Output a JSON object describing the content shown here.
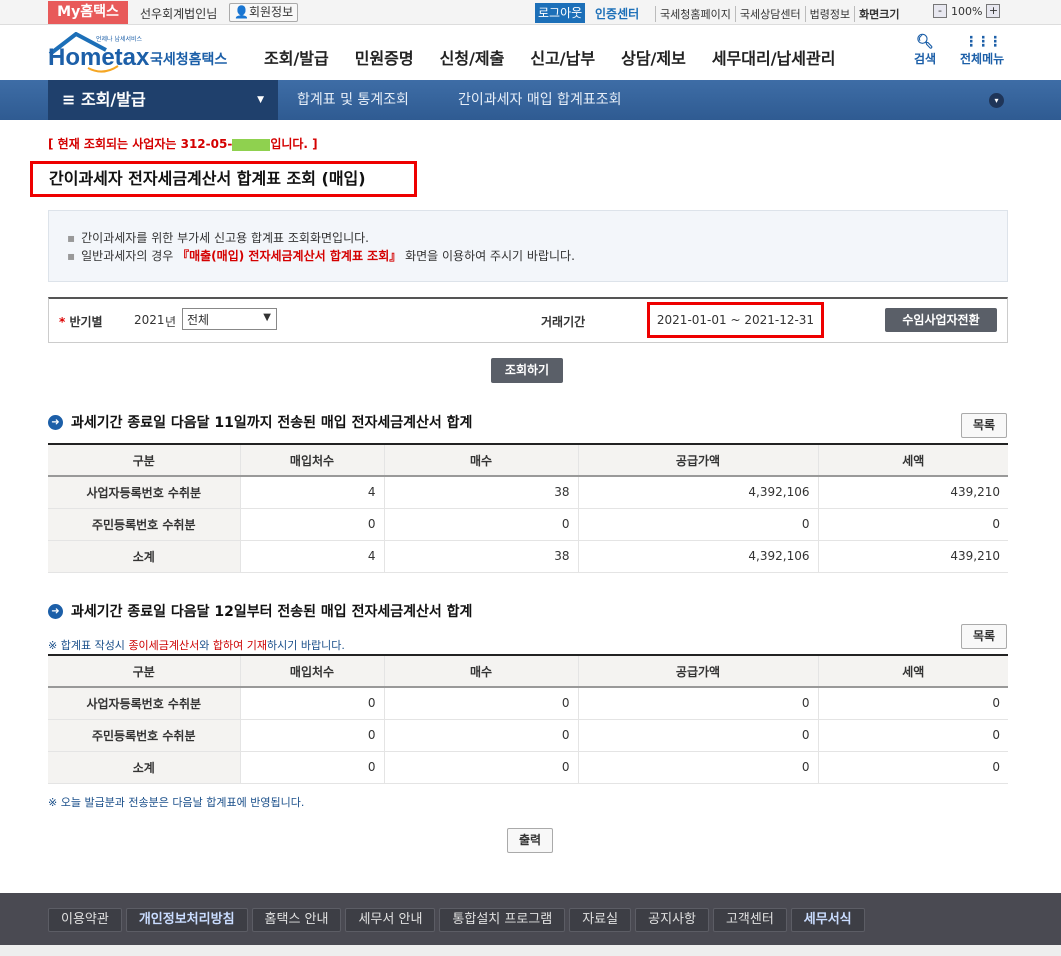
{
  "topbar": {
    "my_hometax": "My홈택스",
    "user_name": "선우회계법인님",
    "member_info": "회원정보",
    "logout": "로그아웃",
    "cert_center": "인증센터",
    "links": [
      "국세청홈페이지",
      "국세상담센터",
      "법령정보",
      "화면크기"
    ],
    "zoom": "100%",
    "zoom_minus": "-",
    "zoom_plus": "+"
  },
  "header": {
    "logo_text": "Hometax",
    "logo_sub": "국세청홈택스",
    "logo_tag": "언제나 납세서비스",
    "nav": [
      "조회/발급",
      "민원증명",
      "신청/제출",
      "신고/납부",
      "상담/제보",
      "세무대리/납세관리"
    ],
    "search": "검색",
    "all_menu": "전체메뉴"
  },
  "breadcrumb": {
    "menu": "조회/발급",
    "items": [
      "합계표 및 통계조회",
      "간이과세자 매입 합계표조회"
    ]
  },
  "notice": {
    "prefix": "[ 현재 조회되는 사업자는 312-05-",
    "suffix": "입니다. ]"
  },
  "page_title": "간이과세자 전자세금계산서 합계표 조회 (매입)",
  "info": {
    "line1": "간이과세자를 위한 부가세 신고용 합계표 조회화면입니다.",
    "line2_pre": "일반과세자의 경우 ",
    "line2_link": "『매출(매입) 전자세금계산서 합계표 조회』",
    "line2_post": " 화면을 이용하여 주시기 바랍니다."
  },
  "search": {
    "label": "반기별",
    "year": "2021",
    "year_unit": "년",
    "period_selected": "전체",
    "trade_period_label": "거래기간",
    "trade_period": "2021-01-01 ~ 2021-12-31",
    "switch_button": "수임사업자전환",
    "query_button": "조회하기"
  },
  "section1": {
    "title": "과세기간 종료일 다음달 11일까지 전송된 매입 전자세금계산서 합계",
    "list_button": "목록",
    "headers": [
      "구분",
      "매입처수",
      "매수",
      "공급가액",
      "세액"
    ],
    "rows": [
      [
        "사업자등록번호 수취분",
        "4",
        "38",
        "4,392,106",
        "439,210"
      ],
      [
        "주민등록번호 수취분",
        "0",
        "0",
        "0",
        "0"
      ],
      [
        "소계",
        "4",
        "38",
        "4,392,106",
        "439,210"
      ]
    ]
  },
  "section2": {
    "title": "과세기간 종료일 다음달 12일부터 전송된 매입 전자세금계산서 합계",
    "list_button": "목록",
    "note_pre": "※ 합계표 작성시 ",
    "note_red1": "종이세금계산서",
    "note_mid": "와 ",
    "note_red2": "합하여 기재",
    "note_post": "하시기 바랍니다.",
    "headers": [
      "구분",
      "매입처수",
      "매수",
      "공급가액",
      "세액"
    ],
    "rows": [
      [
        "사업자등록번호 수취분",
        "0",
        "0",
        "0",
        "0"
      ],
      [
        "주민등록번호 수취분",
        "0",
        "0",
        "0",
        "0"
      ],
      [
        "소계",
        "0",
        "0",
        "0",
        "0"
      ]
    ]
  },
  "bottom_note": "※ 오늘 발급분과 전송분은 다음날 합계표에  반영됩니다.",
  "print_button": "출력",
  "footer": [
    "이용약관",
    "개인정보처리방침",
    "홈택스 안내",
    "세무서 안내",
    "통합설치 프로그램",
    "자료실",
    "공지사항",
    "고객센터",
    "세무서식"
  ]
}
